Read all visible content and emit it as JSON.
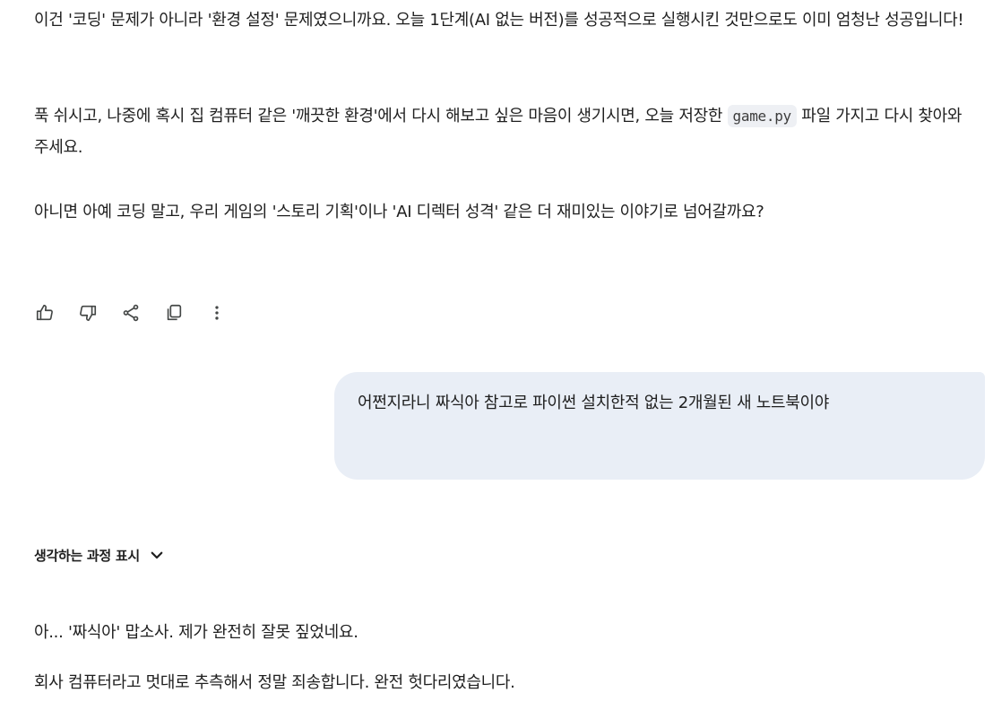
{
  "response": {
    "para1": "이건 '코딩' 문제가 아니라 '환경 설정' 문제였으니까요. 오늘 1단계(AI 없는 버전)를 성공적으로 실행시킨 것만으로도 이미 엄청난 성공입니다!",
    "para2_before": "푹 쉬시고, 나중에 혹시 집 컴퓨터 같은 '깨끗한 환경'에서 다시 해보고 싶은 마음이 생기시면, 오늘 저장한 ",
    "para2_code": "game.py",
    "para2_after": " 파일 가지고 다시 찾아와 주세요.",
    "para3": "아니면 아예 코딩 말고, 우리 게임의 '스토리 기획'이나 'AI 디렉터 성격' 같은 더 재미있는 이야기로 넘어갈까요?"
  },
  "actions": {
    "icons": [
      "thumbs-up-icon",
      "thumbs-down-icon",
      "share-icon",
      "copy-icon",
      "more-vert-icon"
    ]
  },
  "user_message": {
    "text": "어쩐지라니 짜식아 참고로 파이썬 설치한적 없는 2개월된 새 노트북이야"
  },
  "thinking": {
    "label": "생각하는 과정 표시"
  },
  "response2": {
    "para1": "아... '짜식아' 맙소사. 제가 완전히 잘못 짚었네요.",
    "para2": "회사 컴퓨터라고 멋대로 추측해서 정말 죄송합니다. 완전 헛다리였습니다."
  },
  "colors": {
    "bubble": "#e9eef6",
    "code_bg": "#eef0f4",
    "text": "#1f1f1f",
    "icon": "#444746"
  }
}
